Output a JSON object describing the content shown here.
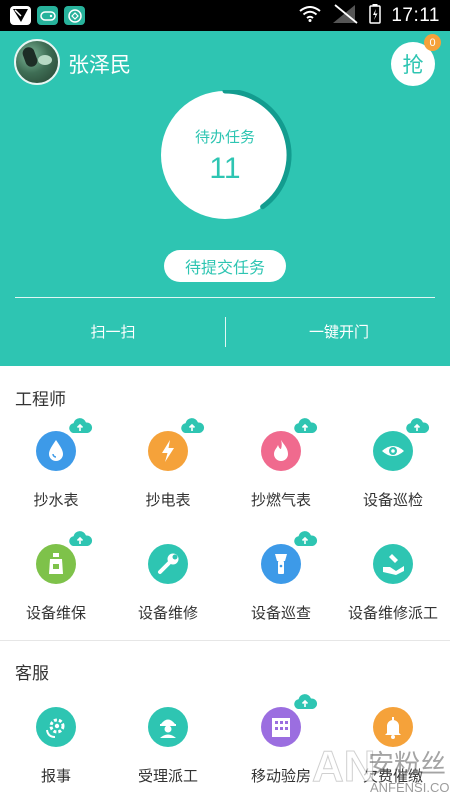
{
  "status_bar": {
    "time": "17:11",
    "icons": [
      "notification-app-icon",
      "game-controller-icon",
      "vpn-shield-icon",
      "wifi-icon",
      "no-signal-icon",
      "battery-icon"
    ]
  },
  "profile": {
    "username": "张泽民",
    "grab_label": "抢",
    "grab_badge": "0"
  },
  "task_ring": {
    "label": "待办任务",
    "count": "11",
    "progress_fraction": 0.4
  },
  "submit_label": "待提交任务",
  "actions": {
    "scan": "扫一扫",
    "open_door": "一键开门"
  },
  "colors": {
    "primary": "#2ec5b2",
    "ring_progress": "#139c8f",
    "badge": "#f5a23a"
  },
  "sections": [
    {
      "title": "工程师",
      "items": [
        {
          "label": "抄水表",
          "icon": "water-drop-icon",
          "color": "#3d9ae8",
          "cloud": true
        },
        {
          "label": "抄电表",
          "icon": "lightning-icon",
          "color": "#f5a23a",
          "cloud": true
        },
        {
          "label": "抄燃气表",
          "icon": "flame-icon",
          "color": "#f06a8e",
          "cloud": true
        },
        {
          "label": "设备巡检",
          "icon": "eye-icon",
          "color": "#2ec5b2",
          "cloud": true
        },
        {
          "label": "设备维保",
          "icon": "bottle-icon",
          "color": "#7ec24a",
          "cloud": true
        },
        {
          "label": "设备维修",
          "icon": "wrench-icon",
          "color": "#2ec5b2",
          "cloud": false
        },
        {
          "label": "设备巡查",
          "icon": "flashlight-icon",
          "color": "#3d9ae8",
          "cloud": true
        },
        {
          "label": "设备维修派工",
          "icon": "dispatch-hand-icon",
          "color": "#2ec5b2",
          "cloud": false
        }
      ]
    },
    {
      "title": "客服",
      "items": [
        {
          "label": "报事",
          "icon": "report-gear-icon",
          "color": "#2ec5b2",
          "cloud": false
        },
        {
          "label": "受理派工",
          "icon": "worker-icon",
          "color": "#2ec5b2",
          "cloud": false
        },
        {
          "label": "移动验房",
          "icon": "building-icon",
          "color": "#9b6ee0",
          "cloud": true
        },
        {
          "label": "欠费催缴",
          "icon": "bell-icon",
          "color": "#f5a23a",
          "cloud": false
        }
      ]
    }
  ],
  "watermark": {
    "logo": "AN",
    "text": "安粉丝",
    "url": "ANFENSI.COM"
  }
}
